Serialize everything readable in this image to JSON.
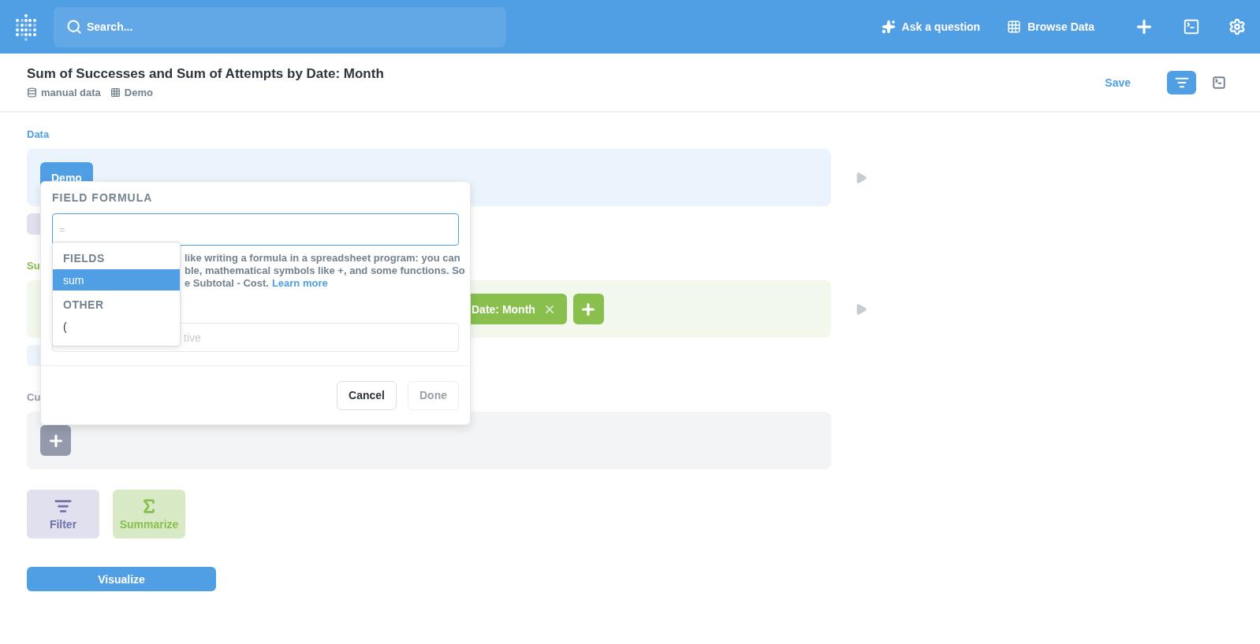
{
  "header": {
    "search": {
      "placeholder": "Search..."
    },
    "actions": [
      {
        "kind": "ask",
        "label": "Ask a question"
      },
      {
        "kind": "browse",
        "label": "Browse Data"
      }
    ]
  },
  "question": {
    "title": "Sum of Successes and Sum of Attempts by Date: Month",
    "breadcrumbs": [
      {
        "kind": "database",
        "label": "manual data"
      },
      {
        "kind": "table",
        "label": "Demo"
      }
    ],
    "save": "Save",
    "modes": [
      {
        "kind": "notebook",
        "selected": true
      },
      {
        "kind": "sql",
        "selected": false
      }
    ]
  },
  "notebook": {
    "steps": [
      {
        "kind": "data",
        "label": "Data",
        "chips": [
          "Demo"
        ]
      },
      {
        "kind": "summarize",
        "label": "Su",
        "chips": [
          "Date: Month"
        ]
      },
      {
        "kind": "custom",
        "label": "Cu"
      }
    ],
    "actions": [
      {
        "kind": "filter",
        "label": "Filter"
      },
      {
        "kind": "summarize",
        "label": "Summarize"
      }
    ],
    "visualize": "Visualize"
  },
  "popover": {
    "title": "FIELD FORMULA",
    "formula": {
      "placeholder": "="
    },
    "help_lines": [
      "like writing a formula in a spreadsheet program: you can",
      "ble, mathematical symbols like +, and some functions. So",
      "e Subtotal - Cost."
    ],
    "help_link": "Learn more",
    "name": {
      "placeholder": "tive"
    },
    "buttons": [
      {
        "label": "Cancel",
        "disabled": false
      },
      {
        "label": "Done",
        "disabled": true
      }
    ],
    "suggestions": [
      {
        "heading": "FIELDS",
        "items": [
          {
            "label": "sum",
            "selected": true
          }
        ]
      },
      {
        "heading": "OTHER",
        "items": [
          {
            "label": "(",
            "selected": false
          }
        ]
      }
    ]
  }
}
